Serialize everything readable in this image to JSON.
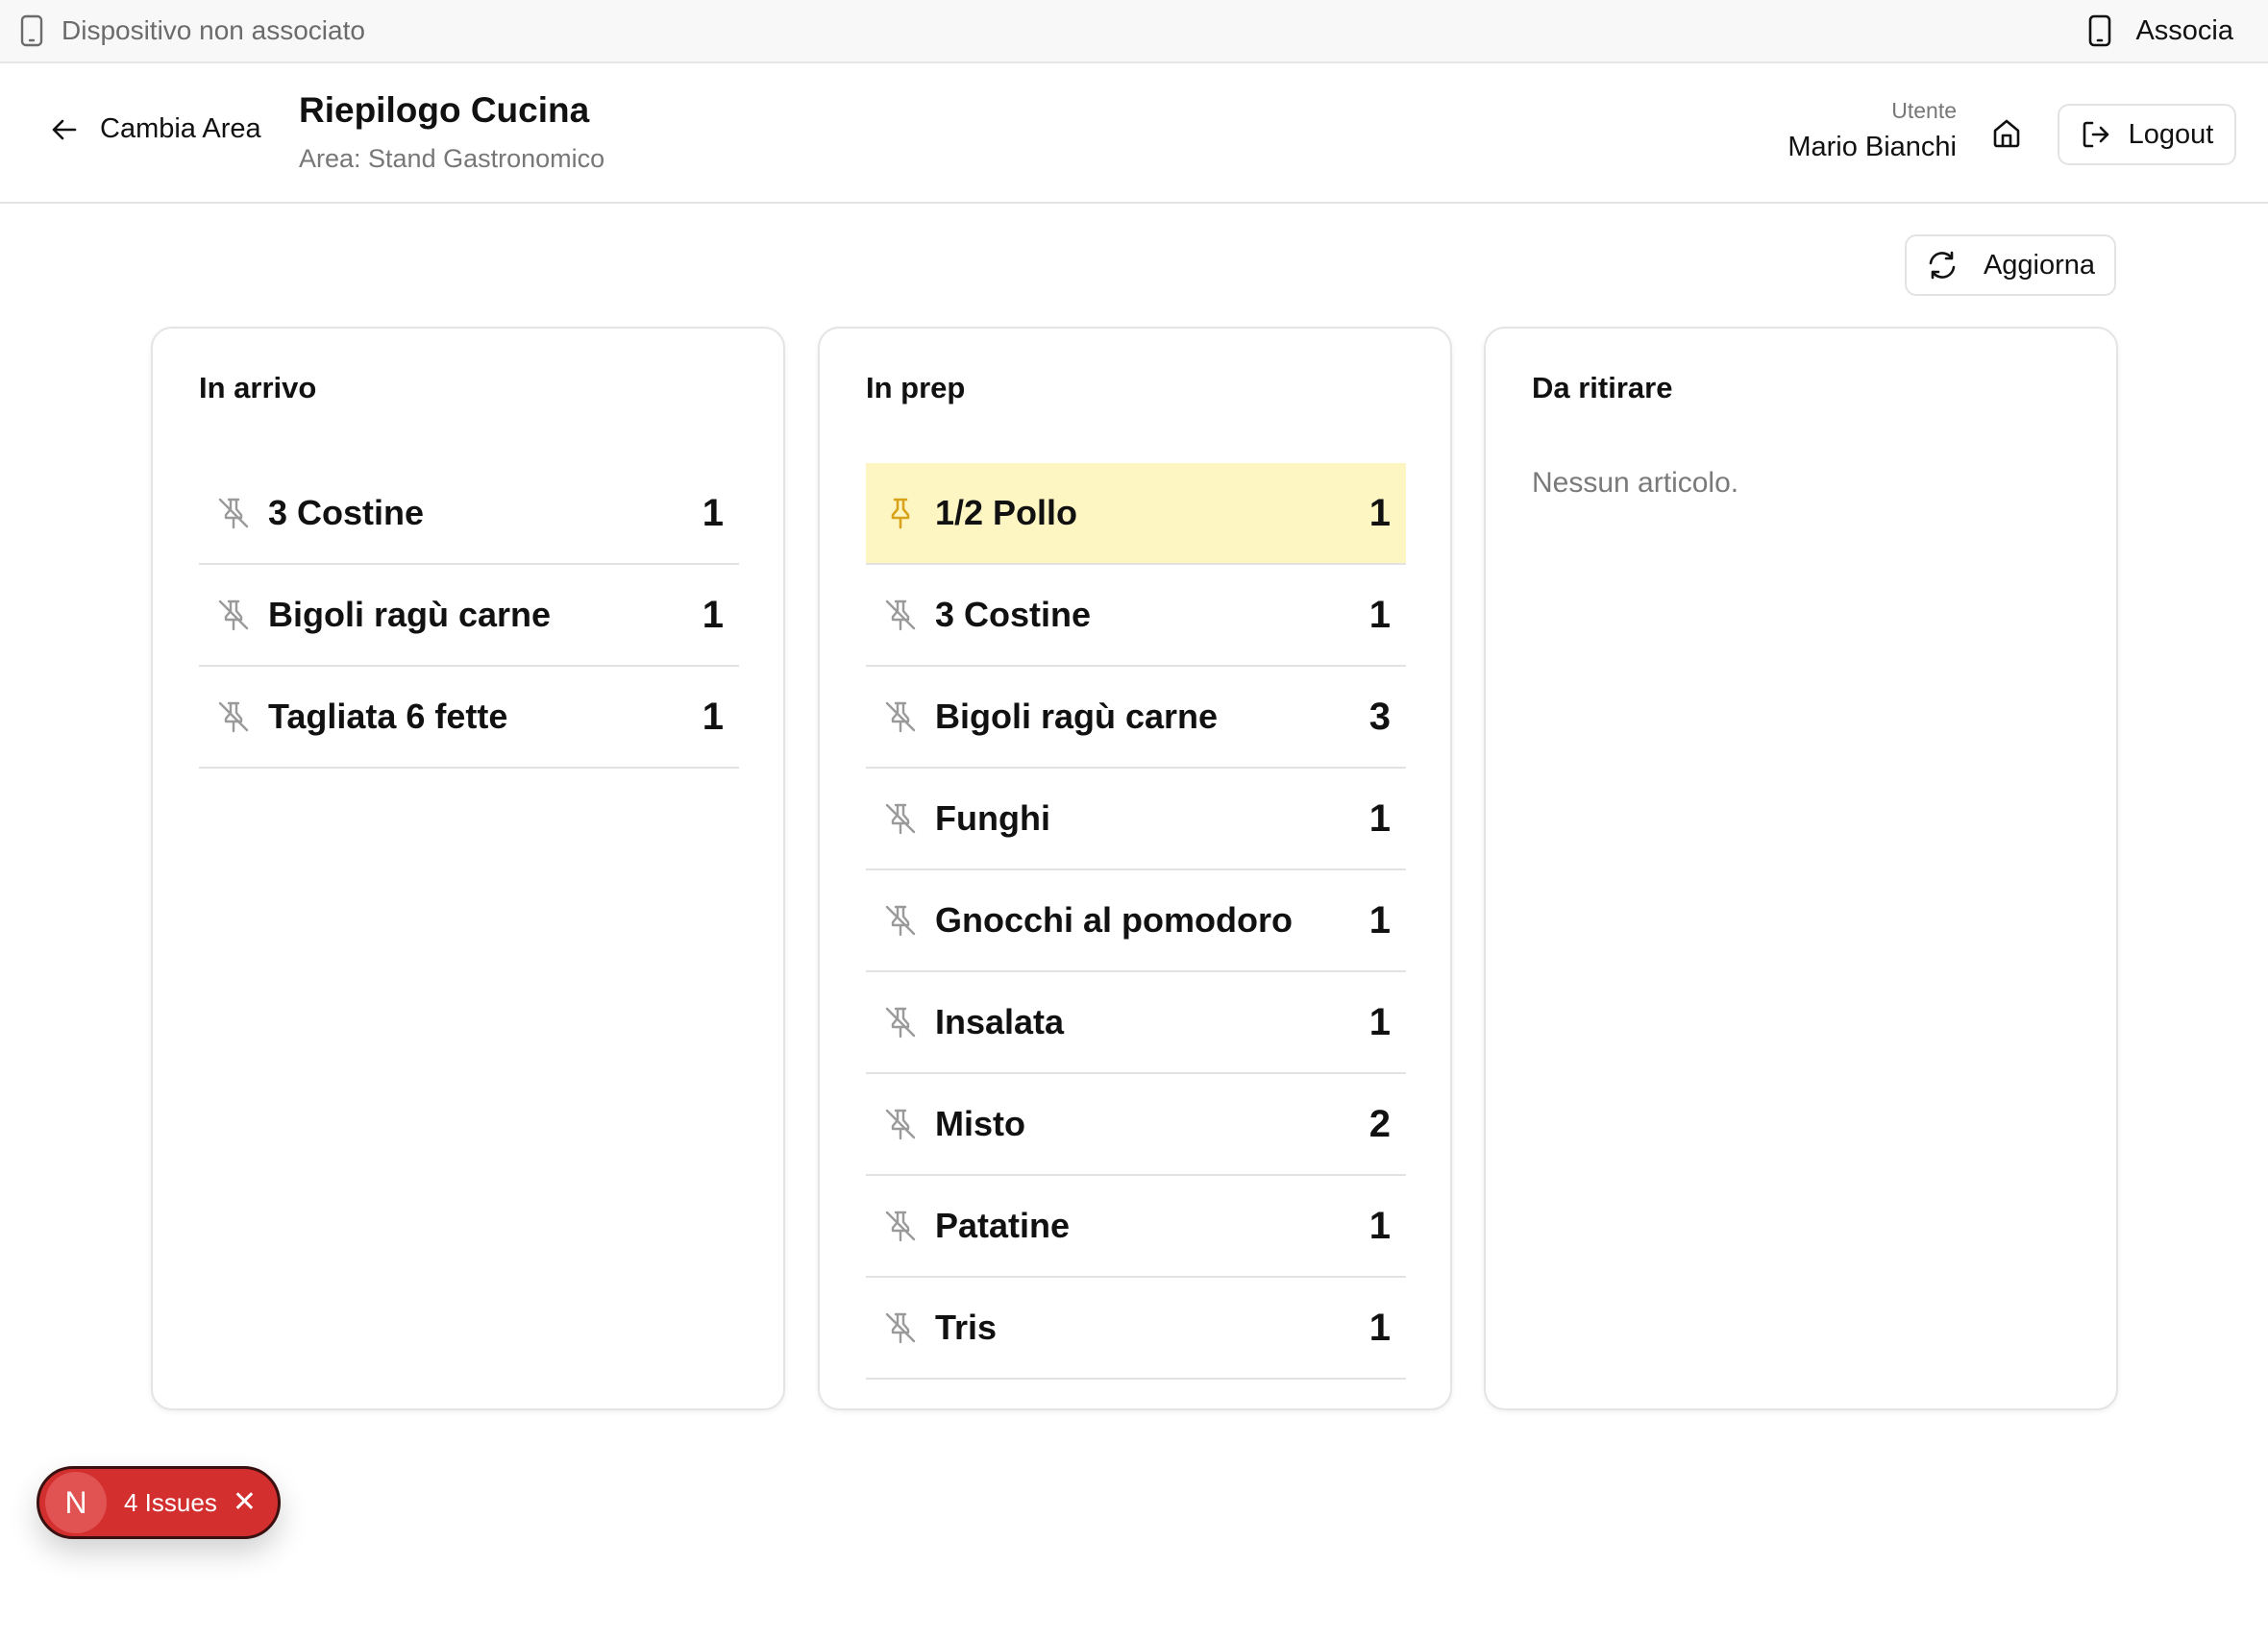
{
  "device_bar": {
    "status": "Dispositivo non associato",
    "associate_label": "Associa"
  },
  "header": {
    "back_label": "Cambia Area",
    "title": "Riepilogo Cucina",
    "subtitle": "Area: Stand Gastronomico",
    "user_label": "Utente",
    "user_name": "Mario Bianchi",
    "logout_label": "Logout"
  },
  "toolbar": {
    "refresh_label": "Aggiorna"
  },
  "columns": [
    {
      "title": "In arrivo",
      "items": [
        {
          "name": "3 Costine",
          "qty": "1",
          "pinned": false
        },
        {
          "name": "Bigoli ragù carne",
          "qty": "1",
          "pinned": false
        },
        {
          "name": "Tagliata 6 fette",
          "qty": "1",
          "pinned": false
        }
      ]
    },
    {
      "title": "In prep",
      "items": [
        {
          "name": "1/2 Pollo",
          "qty": "1",
          "pinned": true
        },
        {
          "name": "3 Costine",
          "qty": "1",
          "pinned": false
        },
        {
          "name": "Bigoli ragù carne",
          "qty": "3",
          "pinned": false
        },
        {
          "name": "Funghi",
          "qty": "1",
          "pinned": false
        },
        {
          "name": "Gnocchi al pomodoro",
          "qty": "1",
          "pinned": false
        },
        {
          "name": "Insalata",
          "qty": "1",
          "pinned": false
        },
        {
          "name": "Misto",
          "qty": "2",
          "pinned": false
        },
        {
          "name": "Patatine",
          "qty": "1",
          "pinned": false
        },
        {
          "name": "Tris",
          "qty": "1",
          "pinned": false
        }
      ]
    },
    {
      "title": "Da ritirare",
      "items": [],
      "empty_text": "Nessun articolo."
    }
  ],
  "issues_toast": {
    "logo": "N",
    "label": "4 Issues",
    "close": "✕"
  },
  "colors": {
    "pinned_bg": "#fdf6c3",
    "pin_active": "#d9a21b",
    "pin_inactive": "#9a9a9a",
    "issues_bg": "#d32f2f"
  },
  "icons": {
    "device": "phone-icon",
    "back": "arrow-left-icon",
    "home": "home-icon",
    "logout": "logout-icon",
    "refresh": "refresh-icon",
    "pin": "pin-icon",
    "pin_off": "pin-off-icon"
  }
}
